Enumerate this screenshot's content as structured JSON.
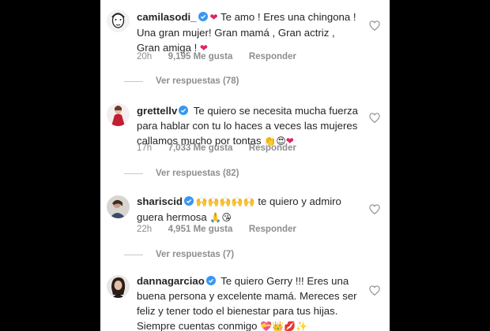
{
  "comments": [
    {
      "username": "camilasodi_",
      "text": "Te amo ! Eres una chingona ! Una gran mujer! Gran mamá , Gran actriz , Gran amiga !",
      "time": "20h",
      "likes": "9,195 Me gusta",
      "reply": "Responder",
      "view_replies": "Ver respuestas (78)",
      "avatar_icon": "sketch-portrait-avatar"
    },
    {
      "username": "grettellv",
      "text": "Te quiero se necesita mucha fuerza para hablar con tu lo haces a veces las mujeres callamos mucho por tontas",
      "time": "17h",
      "likes": "7,033 Me gusta",
      "reply": "Responder",
      "view_replies": "Ver respuestas (82)",
      "avatar_icon": "woman-red-dress-avatar"
    },
    {
      "username": "shariscid",
      "text": "te quiero y admiro guera hermosa",
      "time": "22h",
      "likes": "4,951 Me gusta",
      "reply": "Responder",
      "view_replies": "Ver respuestas (7)",
      "avatar_icon": "profile-photo-avatar"
    },
    {
      "username": "dannagarciao",
      "text": "Te quiero Gerry !!! Eres una buena persona y excelente mamá. Mereces ser feliz y tener todo el bienestar para tus hijas. Siempre cuentas conmigo",
      "avatar_icon": "woman-portrait-avatar"
    }
  ],
  "colors": {
    "text": "#262626",
    "secondary": "#8e8e8e",
    "verified": "#3897f0",
    "heart": "#ed4956",
    "background": "#ffffff",
    "letterbox": "#000000"
  }
}
